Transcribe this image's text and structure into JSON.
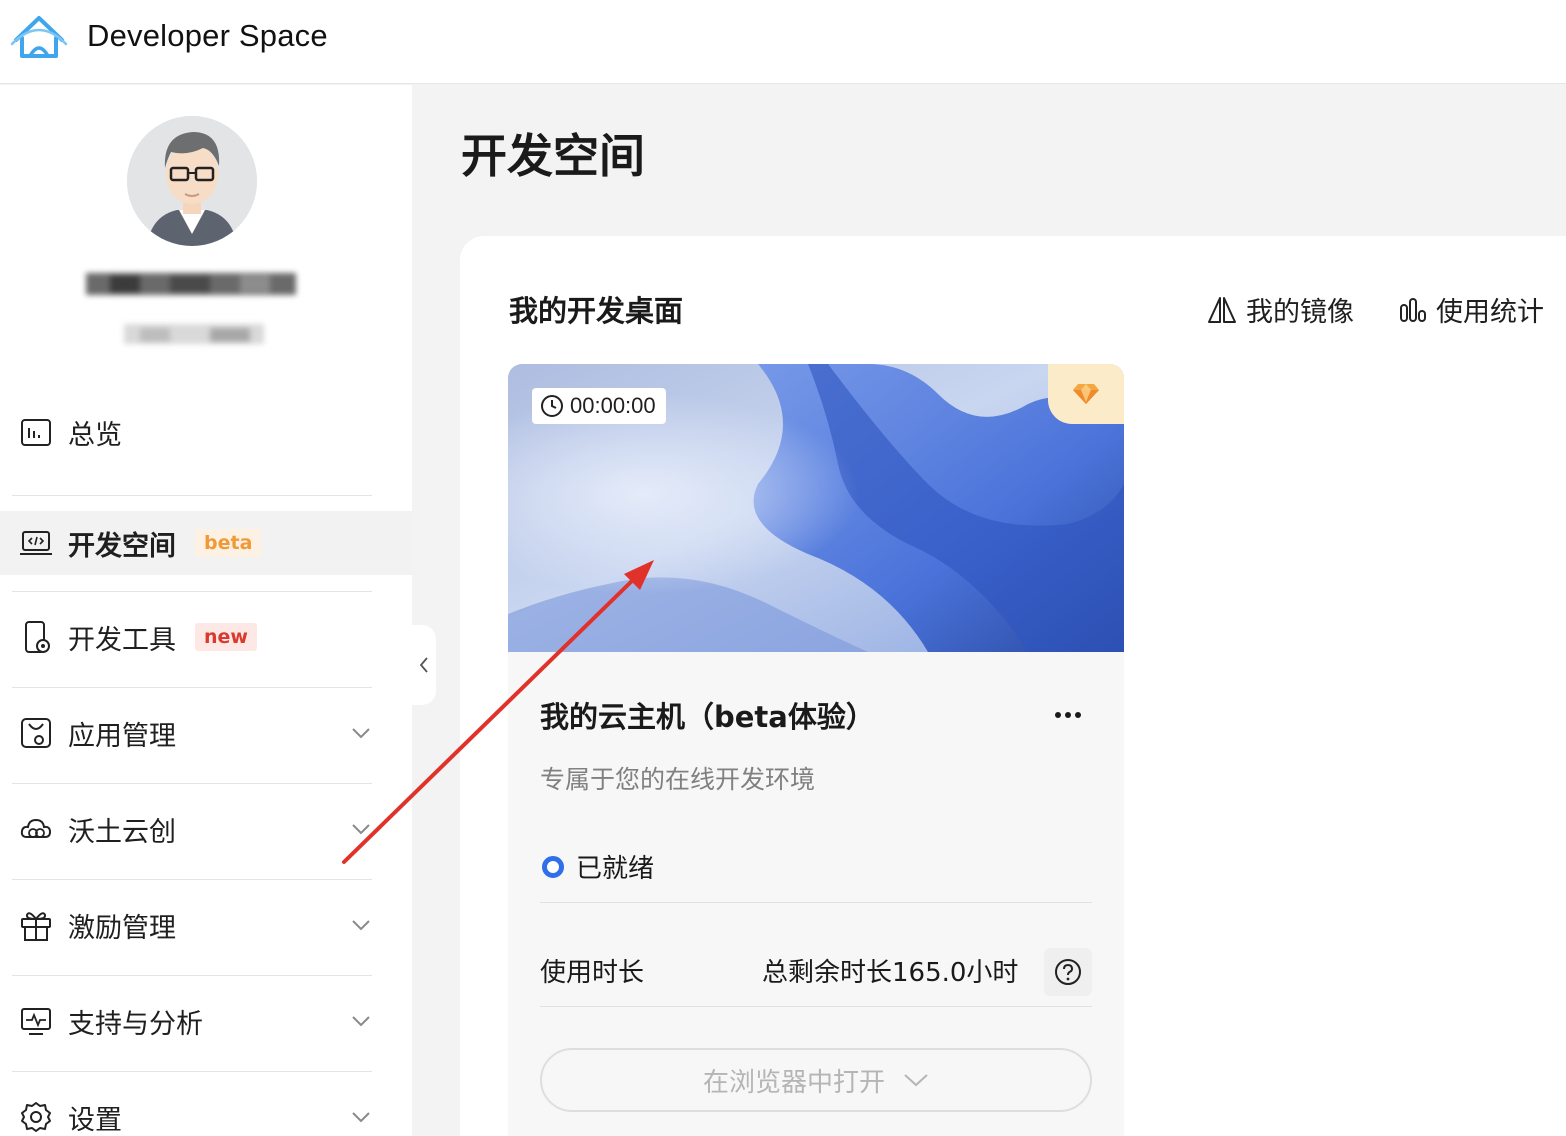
{
  "header": {
    "brand": "Developer Space"
  },
  "sidebar": {
    "items": [
      {
        "label": "总览",
        "icon": "chart-icon"
      },
      {
        "label": "开发空间",
        "icon": "code-laptop-icon",
        "tag": "beta",
        "active": true
      },
      {
        "label": "开发工具",
        "icon": "device-gear-icon",
        "tag": "new"
      },
      {
        "label": "应用管理",
        "icon": "app-bag-icon"
      },
      {
        "label": "沃土云创",
        "icon": "cloud-icon"
      },
      {
        "label": "激励管理",
        "icon": "gift-icon"
      },
      {
        "label": "支持与分析",
        "icon": "monitor-pulse-icon"
      },
      {
        "label": "设置",
        "icon": "gear-icon"
      }
    ]
  },
  "main": {
    "page_title": "开发空间",
    "section_title": "我的开发桌面",
    "links": {
      "images": "我的镜像",
      "stats": "使用统计"
    },
    "card": {
      "timer": "00:00:00",
      "title": "我的云主机（beta体验）",
      "description": "专属于您的在线开发环境",
      "status": "已就绪",
      "usage_label": "使用时长",
      "usage_value": "总剩余时长165.0小时",
      "open_button": "在浏览器中打开"
    }
  },
  "colors": {
    "accent_blue": "#2f6fe9",
    "beta_tag": "#f09a37",
    "new_tag": "#d93a2e",
    "annotation_arrow": "#e0322b"
  }
}
